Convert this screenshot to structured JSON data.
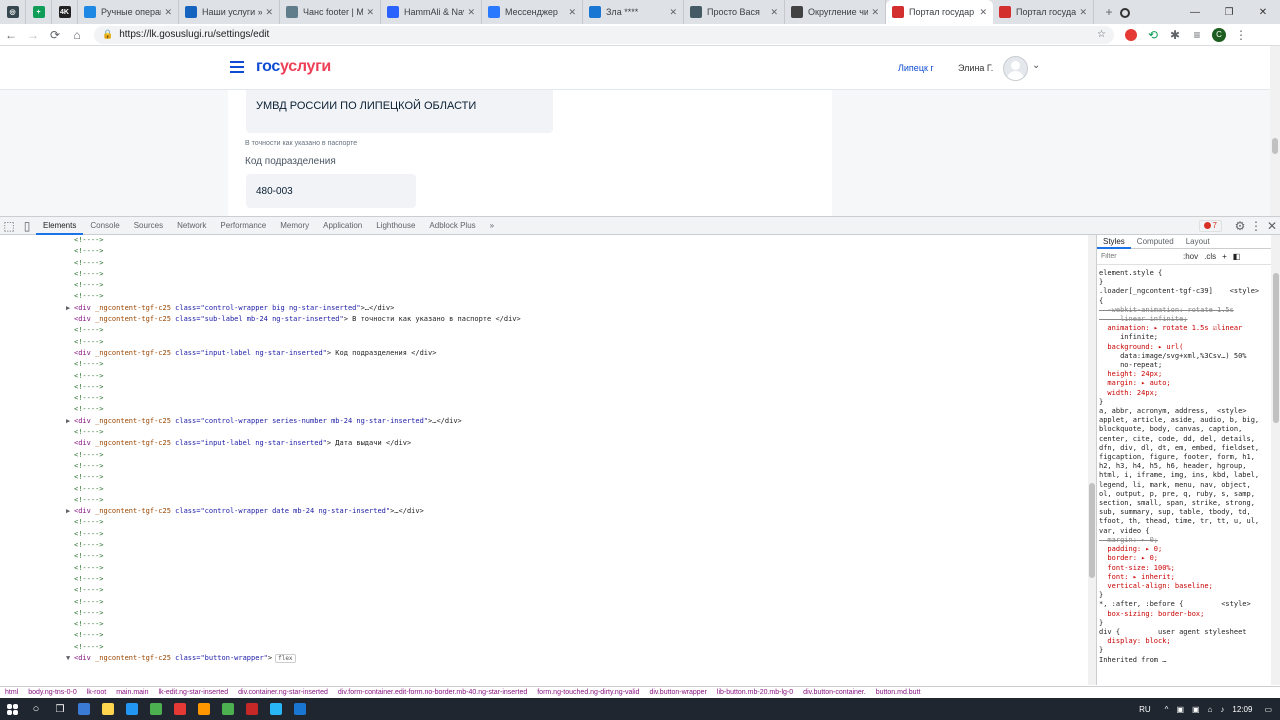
{
  "tabs": [
    {
      "title": "Ручные операц",
      "color": "#1e88e5"
    },
    {
      "title": "Наши услуги » Р",
      "color": "#1565c0"
    },
    {
      "title": "Чанс footer | М",
      "color": "#607d8b"
    },
    {
      "title": "HammAli & Navi",
      "color": "#2962ff"
    },
    {
      "title": "Мессенджер",
      "color": "#2979ff"
    },
    {
      "title": "Зла ****",
      "color": "#1976d2"
    },
    {
      "title": "Просто Вася",
      "color": "#455a64"
    },
    {
      "title": "Округление чис",
      "color": "#424242"
    },
    {
      "title": "Портал государ",
      "color": "#d32f2f"
    },
    {
      "title": "Портал государ",
      "color": "#d32f2f"
    }
  ],
  "pinned": [
    {
      "icon": "photo-app-icon",
      "color": "#37474f",
      "glyph": "◎"
    },
    {
      "icon": "sheets-icon",
      "color": "#0f9d58",
      "glyph": "+"
    },
    {
      "icon": "4k-icon",
      "color": "#212121",
      "glyph": "4K"
    }
  ],
  "url": "https://lk.gosuslugi.ru/settings/edit",
  "site": {
    "logo_gos": "гос",
    "logo_uslugi": "услуги",
    "region": "Липецк г",
    "user": "Элина Г."
  },
  "form": {
    "issued_by": "УМВД РОССИИ ПО ЛИПЕЦКОЙ ОБЛАСТИ",
    "sub_label": "В точности как указано в паспорте",
    "code_label": "Код подразделения",
    "code_value": "480-003"
  },
  "devtools": {
    "tabs": [
      "Elements",
      "Console",
      "Sources",
      "Network",
      "Performance",
      "Memory",
      "Application",
      "Lighthouse",
      "Adblock Plus"
    ],
    "error_count": "7",
    "styles_tabs": [
      "Styles",
      "Computed",
      "Layout"
    ],
    "filter_placeholder": "Filter",
    "hov": ":hov",
    "cls": ".cls",
    "dom_lines": [
      {
        "t": "c",
        "text": "<!---->"
      },
      {
        "t": "c",
        "text": "<!---->"
      },
      {
        "t": "c",
        "text": "<!---->"
      },
      {
        "t": "c",
        "text": "<!---->"
      },
      {
        "t": "c",
        "text": "<!---->"
      },
      {
        "t": "c",
        "text": "<!---->"
      },
      {
        "t": "e",
        "arrow": "▶",
        "attr": "class=\"control-wrapper big ng-star-inserted\"",
        "after": ">…</div>"
      },
      {
        "t": "e",
        "attr": "class=\"sub-label mb-24 ng-star-inserted\"",
        "after": "> В точности как указано в паспорте </div>"
      },
      {
        "t": "c",
        "text": "<!---->"
      },
      {
        "t": "c",
        "text": "<!---->"
      },
      {
        "t": "e",
        "attr": "class=\"input-label ng-star-inserted\"",
        "after": "> Код подразделения </div>"
      },
      {
        "t": "c",
        "text": "<!---->"
      },
      {
        "t": "c",
        "text": "<!---->"
      },
      {
        "t": "c",
        "text": "<!---->"
      },
      {
        "t": "c",
        "text": "<!---->"
      },
      {
        "t": "c",
        "text": "<!---->"
      },
      {
        "t": "e",
        "arrow": "▶",
        "attr": "class=\"control-wrapper series-number mb-24 ng-star-inserted\"",
        "after": ">…</div>"
      },
      {
        "t": "c",
        "text": "<!---->"
      },
      {
        "t": "e",
        "attr": "class=\"input-label ng-star-inserted\"",
        "after": "> Дата выдачи </div>"
      },
      {
        "t": "c",
        "text": "<!---->"
      },
      {
        "t": "c",
        "text": "<!---->"
      },
      {
        "t": "c",
        "text": "<!---->"
      },
      {
        "t": "c",
        "text": "<!---->"
      },
      {
        "t": "c",
        "text": "<!---->"
      },
      {
        "t": "e",
        "arrow": "▶",
        "attr": "class=\"control-wrapper date mb-24 ng-star-inserted\"",
        "after": ">…</div>"
      },
      {
        "t": "c",
        "text": "<!---->"
      },
      {
        "t": "c",
        "text": "<!---->"
      },
      {
        "t": "c",
        "text": "<!---->"
      },
      {
        "t": "c",
        "text": "<!---->"
      },
      {
        "t": "c",
        "text": "<!---->"
      },
      {
        "t": "c",
        "text": "<!---->"
      },
      {
        "t": "c",
        "text": "<!---->"
      },
      {
        "t": "c",
        "text": "<!---->"
      },
      {
        "t": "c",
        "text": "<!---->"
      },
      {
        "t": "c",
        "text": "<!---->"
      },
      {
        "t": "c",
        "text": "<!---->"
      },
      {
        "t": "c",
        "text": "<!---->"
      },
      {
        "t": "e",
        "arrow": "▼",
        "attr": "class=\"button-wrapper\"",
        "after": ">",
        "badge": "flex"
      }
    ],
    "tag_open": "<div",
    "ng_attr": "_ngcontent-tgf-c25",
    "style_lines": [
      "element.style {",
      "}",
      ".loader[_ngcontent-tgf-c39]    <style>",
      "{",
      "  -webkit-animation: rotate 1.5s",
      "     linear infinite;",
      "  animation: ▸ rotate 1.5s ☑linear",
      "     infinite;",
      "  background: ▸ url(",
      "     data:image/svg+xml,%3Csv…) 50%",
      "     no-repeat;",
      "  height: 24px;",
      "  margin: ▸ auto;",
      "  width: 24px;",
      "}",
      "a, abbr, acronym, address,  <style>",
      "applet, article, aside, audio, b, big,",
      "blockquote, body, canvas, caption,",
      "center, cite, code, dd, del, details,",
      "dfn, div, dl, dt, em, embed, fieldset,",
      "figcaption, figure, footer, form, h1,",
      "h2, h3, h4, h5, h6, header, hgroup,",
      "html, i, iframe, img, ins, kbd, label,",
      "legend, li, mark, menu, nav, object,",
      "ol, output, p, pre, q, ruby, s, samp,",
      "section, small, span, strike, strong,",
      "sub, summary, sup, table, tbody, td,",
      "tfoot, th, thead, time, tr, tt, u, ul,",
      "var, video {",
      "  margin: ▸ 0;",
      "  padding: ▸ 0;",
      "  border: ▸ 0;",
      "  font-size: 100%;",
      "  font: ▸ inherit;",
      "  vertical-align: baseline;",
      "}",
      "*, :after, :before {         <style>",
      "  box-sizing: border-box;",
      "}",
      "div {         user agent stylesheet",
      "  display: block;",
      "}",
      "Inherited from …"
    ],
    "crumbs": [
      "html",
      "body.ng-tns-0-0",
      "lk-root",
      "main.main",
      "lk-edit.ng-star-inserted",
      "div.container.ng-star-inserted",
      "div.form-container.edit-form.no-border.mb-40.ng-star-inserted",
      "form.ng-touched.ng-dirty.ng-valid",
      "div.button-wrapper",
      "lib-button.mb-20.mb-lg-0",
      "div.button-container.",
      "button.md.butt"
    ]
  },
  "taskbar": {
    "lang": "RU",
    "time": "12:09",
    "apps": [
      "#3a7bd5",
      "#ffd54f",
      "#2196f3",
      "#4caf50",
      "#e53935",
      "#ff9800",
      "#4caf50",
      "#c62828",
      "#29b6f6",
      "#1976d2"
    ]
  }
}
